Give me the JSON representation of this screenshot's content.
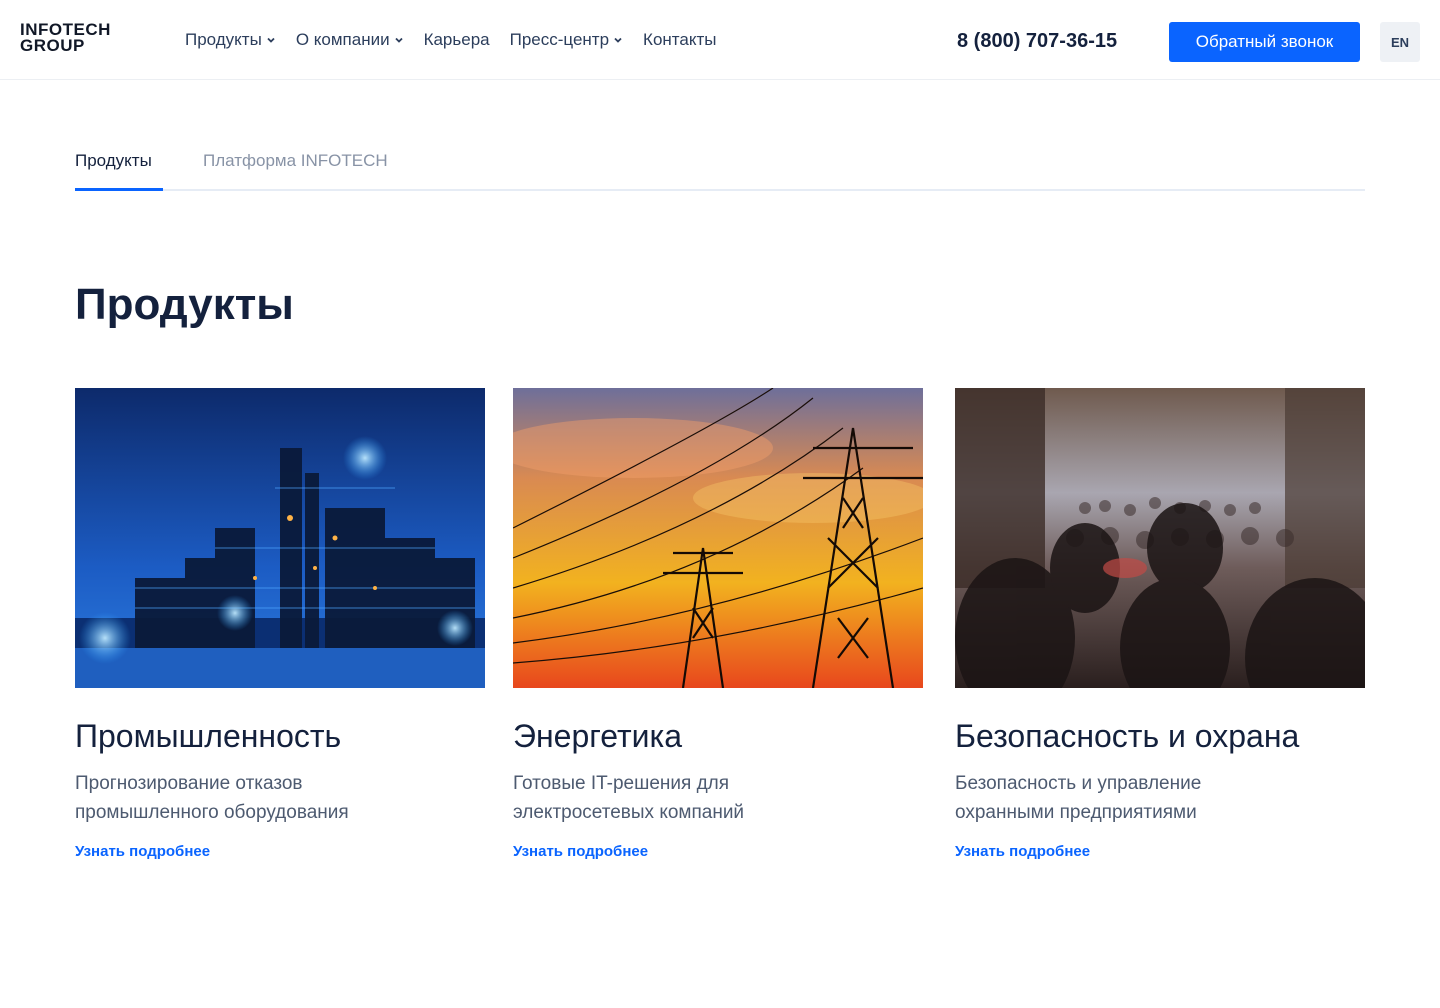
{
  "brand": {
    "logo_line1": "INFOTECH",
    "logo_line2": "GROUP",
    "accent_color": "#0a64ff",
    "text_color": "#14213d"
  },
  "nav": {
    "items": [
      {
        "label": "Продукты",
        "has_dropdown": true
      },
      {
        "label": "О компании",
        "has_dropdown": true
      },
      {
        "label": "Карьера",
        "has_dropdown": false
      },
      {
        "label": "Пресс-центр",
        "has_dropdown": true
      },
      {
        "label": "Контакты",
        "has_dropdown": false
      }
    ]
  },
  "header": {
    "phone": "8 (800) 707-36-15",
    "callback_label": "Обратный звонок",
    "lang_label": "EN"
  },
  "tabs": [
    {
      "label": "Продукты",
      "active": true
    },
    {
      "label": "Платформа INFOTECH",
      "active": false
    }
  ],
  "main": {
    "title": "Продукты",
    "cards": [
      {
        "image": "industrial-plant-night",
        "title": "Промышленность",
        "description": "Прогнозирование отказов промышленного оборудования",
        "link": "Узнать подробнее"
      },
      {
        "image": "power-lines-sunset",
        "title": "Энергетика",
        "description": "Готовые IT-решения для электросетевых компаний",
        "link": "Узнать подробнее"
      },
      {
        "image": "crowd-street",
        "title": "Безопасность и охрана",
        "description": "Безопасность и управление охранными предприятиями",
        "link": "Узнать подробнее"
      }
    ]
  }
}
